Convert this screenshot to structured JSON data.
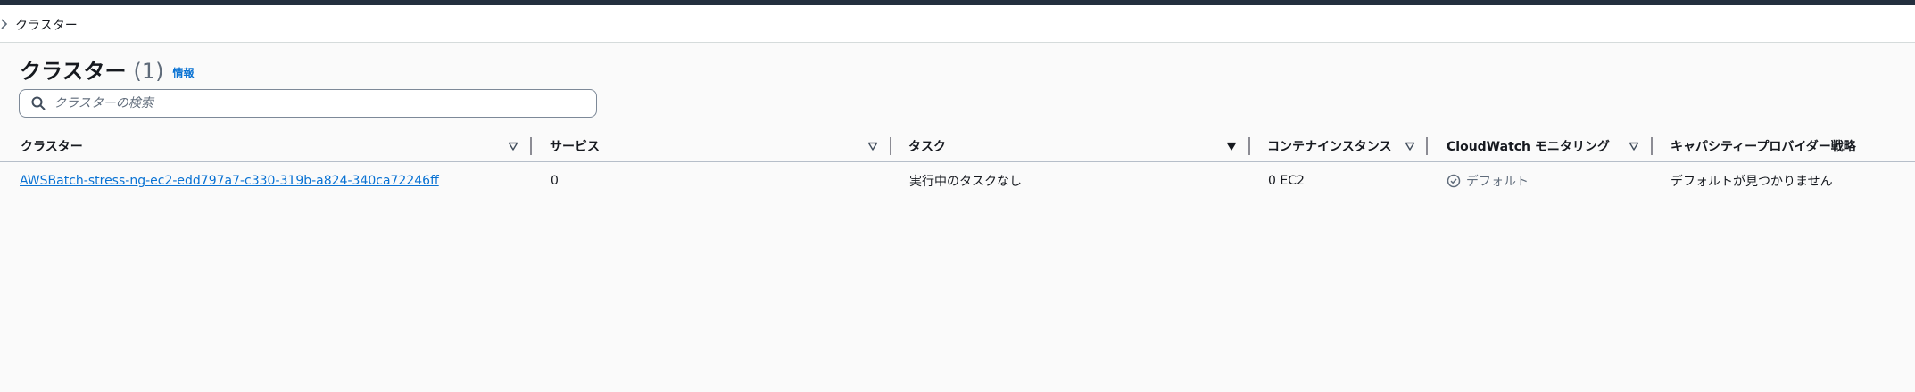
{
  "breadcrumb": {
    "current": "クラスター"
  },
  "header": {
    "title": "クラスター",
    "count": "(1)",
    "info_link": "情報"
  },
  "search": {
    "placeholder": "クラスターの検索",
    "value": ""
  },
  "table": {
    "columns": [
      "クラスター",
      "サービス",
      "タスク",
      "コンテナインスタンス",
      "CloudWatch モニタリング",
      "キャパシティープロバイダー戦略"
    ],
    "rows": [
      {
        "cluster": "AWSBatch-stress-ng-ec2-edd797a7-c330-319b-a824-340ca72246ff",
        "services": "0",
        "tasks": "実行中のタスクなし",
        "container_instances": "0 EC2",
        "cloudwatch": "デフォルト",
        "capacity_strategy": "デフォルトが見つかりません"
      }
    ]
  },
  "colors": {
    "link": "#0972d3",
    "topbar": "#232f3e",
    "muted": "#5f6b7a"
  },
  "icons": [
    "chevron-right-icon",
    "search-icon",
    "sort-icon",
    "check-circle-icon"
  ]
}
